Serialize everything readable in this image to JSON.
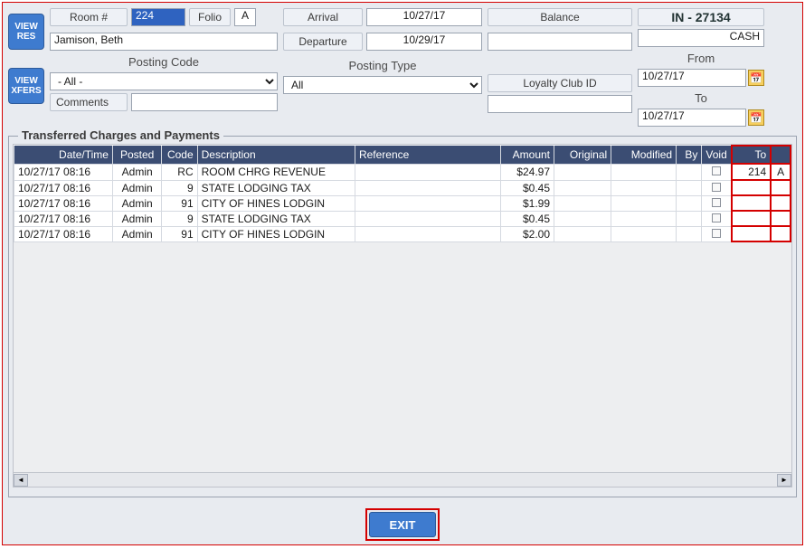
{
  "buttons": {
    "viewRes": "VIEW\nRES",
    "viewXfers": "VIEW\nXFERS",
    "exit": "EXIT"
  },
  "header": {
    "roomLabel": "Room #",
    "roomNumber": "224",
    "folioLabel": "Folio",
    "folioCode": "A",
    "guestName": "Jamison, Beth",
    "arrivalLabel": "Arrival",
    "arrivalDate": "10/27/17",
    "departureLabel": "Departure",
    "departureDate": "10/29/17",
    "balanceLabel": "Balance",
    "balanceValue": "",
    "invoice": "IN - 27134",
    "payType": "CASH",
    "postingCodeLabel": "Posting Code",
    "postingCodeValue": "- All -",
    "postingTypeLabel": "Posting Type",
    "postingTypeValue": "All",
    "loyaltyLabel": "Loyalty Club ID",
    "loyaltyValue": "",
    "commentsLabel": "Comments",
    "commentsValue": "",
    "fromLabel": "From",
    "fromDate": "10/27/17",
    "toLabel": "To",
    "toDate": "10/27/17"
  },
  "gridTitle": "Transferred Charges and Payments",
  "columns": {
    "dateTime": "Date/Time",
    "posted": "Posted",
    "code": "Code",
    "description": "Description",
    "reference": "Reference",
    "amount": "Amount",
    "original": "Original",
    "modified": "Modified",
    "by": "By",
    "void": "Void",
    "to": "To"
  },
  "rows": [
    {
      "dateTime": "10/27/17 08:16",
      "posted": "Admin",
      "code": "RC",
      "description": "ROOM CHRG REVENUE",
      "reference": "",
      "amount": "$24.97",
      "original": "",
      "modified": "",
      "by": "",
      "void": false,
      "toRoom": "214",
      "toFolio": "A"
    },
    {
      "dateTime": "10/27/17 08:16",
      "posted": "Admin",
      "code": "9",
      "description": "STATE LODGING TAX",
      "reference": "",
      "amount": "$0.45",
      "original": "",
      "modified": "",
      "by": "",
      "void": false,
      "toRoom": "",
      "toFolio": ""
    },
    {
      "dateTime": "10/27/17 08:16",
      "posted": "Admin",
      "code": "91",
      "description": "CITY OF HINES LODGIN",
      "reference": "",
      "amount": "$1.99",
      "original": "",
      "modified": "",
      "by": "",
      "void": false,
      "toRoom": "",
      "toFolio": ""
    },
    {
      "dateTime": "10/27/17 08:16",
      "posted": "Admin",
      "code": "9",
      "description": "STATE LODGING TAX",
      "reference": "",
      "amount": "$0.45",
      "original": "",
      "modified": "",
      "by": "",
      "void": false,
      "toRoom": "",
      "toFolio": ""
    },
    {
      "dateTime": "10/27/17 08:16",
      "posted": "Admin",
      "code": "91",
      "description": "CITY OF HINES LODGIN",
      "reference": "",
      "amount": "$2.00",
      "original": "",
      "modified": "",
      "by": "",
      "void": false,
      "toRoom": "",
      "toFolio": ""
    }
  ]
}
